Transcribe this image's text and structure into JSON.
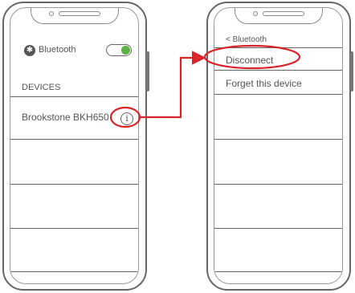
{
  "left_screen": {
    "bluetooth_label": "Bluetooth",
    "bluetooth_icon": "bluetooth-icon",
    "toggle_state": "on",
    "toggle_color": "#5bb040",
    "devices_header": "DEVICES",
    "device_name": "Brookstone BKH650",
    "info_icon": "info-icon",
    "info_glyph": "i"
  },
  "right_screen": {
    "back_label": "< Bluetooth",
    "menu": [
      "Disconnect",
      "Forget this device"
    ]
  },
  "highlight_color": "#d8232a"
}
